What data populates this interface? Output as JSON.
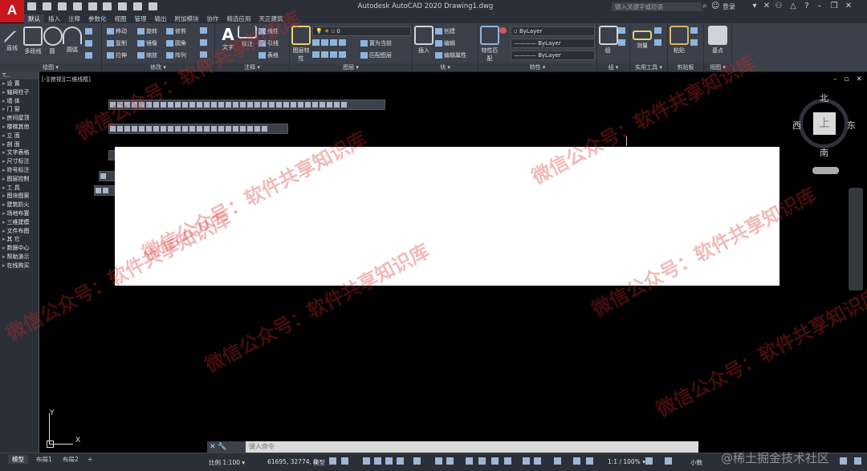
{
  "window": {
    "title": "Autodesk AutoCAD 2020    Drawing1.dwg",
    "search_placeholder": "键入关键字或短语",
    "login": "登录"
  },
  "tabs": [
    "默认",
    "插入",
    "注释",
    "参数化",
    "视图",
    "管理",
    "输出",
    "附加模块",
    "协作",
    "精选应用",
    "天正建筑"
  ],
  "ribbon": {
    "draw": {
      "title": "绘图 ▾",
      "items": [
        "直线",
        "多段线",
        "圆",
        "圆弧"
      ]
    },
    "modify": {
      "title": "修改 ▾",
      "items": [
        "移动",
        "旋转",
        "修剪",
        "复制",
        "镜像",
        "圆角",
        "拉伸",
        "缩放",
        "阵列"
      ]
    },
    "annotation": {
      "title": "注释 ▾",
      "items": [
        "文字",
        "标注",
        "线性",
        "引线",
        "表格"
      ]
    },
    "layers": {
      "title": "图层 ▾",
      "items": [
        "图层特性",
        "置为当前",
        "匹配图层"
      ],
      "current_layer": "0"
    },
    "block": {
      "title": "块 ▾",
      "items": [
        "插入",
        "创建",
        "编辑",
        "编辑属性"
      ]
    },
    "properties": {
      "title": "特性 ▾",
      "items": [
        "特性匹配"
      ],
      "color": "ByLayer",
      "linetype": "ByLayer",
      "lineweight": "ByLayer"
    },
    "groups": {
      "title": "组 ▾",
      "items": [
        "组"
      ]
    },
    "utilities": {
      "title": "实用工具 ▾",
      "items": [
        "测量"
      ]
    },
    "clipboard": {
      "title": "剪贴板",
      "items": [
        "粘贴"
      ]
    },
    "view": {
      "title": "视图 ▾",
      "items": [
        "基点"
      ]
    }
  },
  "palette": {
    "title": "T...",
    "items": [
      "设 置",
      "轴网柱子",
      "墙 体",
      "门 窗",
      "房间屋顶",
      "楼梯其他",
      "立 面",
      "剖 面",
      "文字表格",
      "尺寸标注",
      "符号标注",
      "图层控制",
      "工 具",
      "图块图案",
      "建筑防火",
      "场地布置",
      "三维建模",
      "文件布图",
      "其 它",
      "数据中心",
      "帮助演示",
      "在线购买"
    ]
  },
  "drawing": {
    "view_label": "[-][俯视][二维线框]",
    "window_controls": "– ▫ ✕",
    "compass": {
      "north": "北",
      "south": "南",
      "east": "东",
      "west": "西",
      "face": "上"
    },
    "ucs": {
      "x": "X",
      "y": "Y"
    },
    "watermark": "微信公众号：软件共享知识库"
  },
  "command": {
    "placeholder": "键入命令",
    "controls": "✕ 🔧"
  },
  "status": {
    "layout_tabs": [
      "模型",
      "布局1",
      "布局2"
    ],
    "add_tab": "+",
    "scale": "比例 1:100 ▾",
    "coords": "61695, 32774, 0",
    "mode": "模型",
    "anno_scale": "1:1 / 100% ▾",
    "units": "小数",
    "credit": "@稀土掘金技术社区"
  }
}
